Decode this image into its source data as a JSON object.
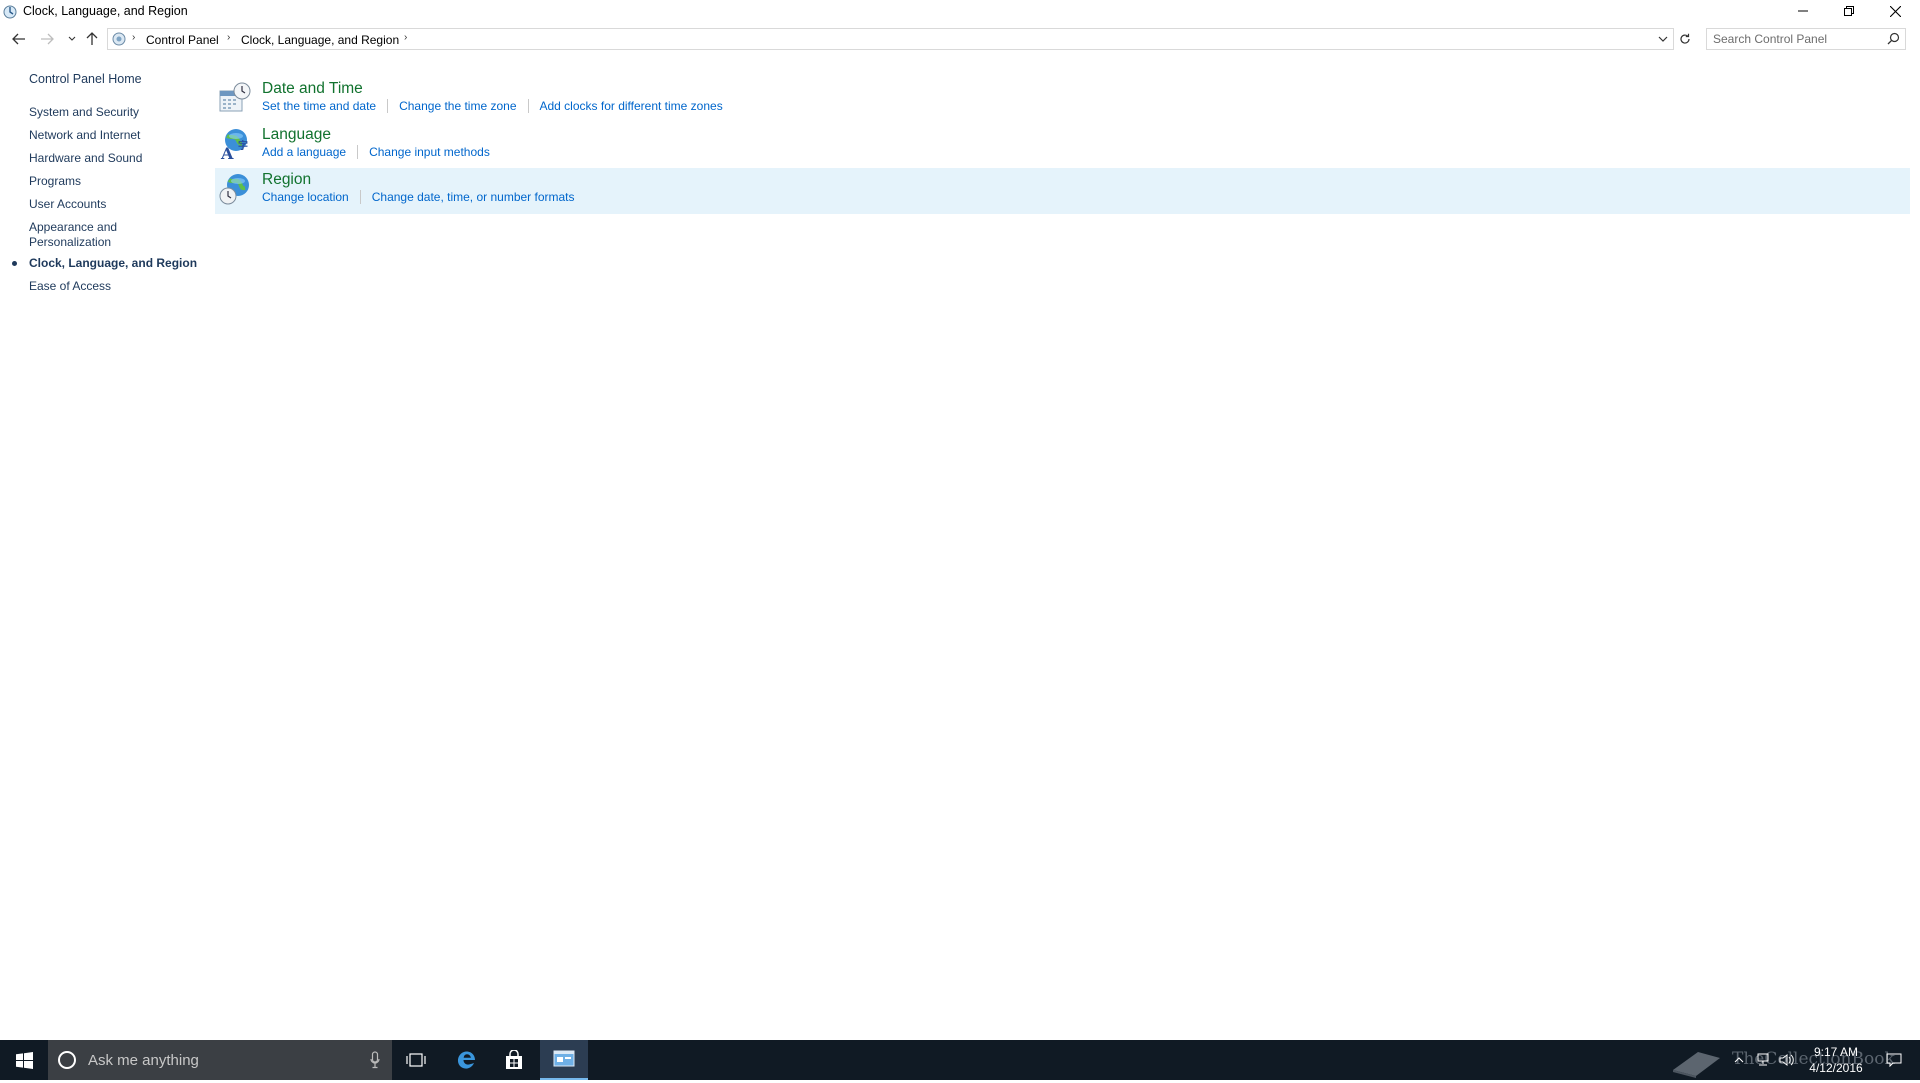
{
  "window": {
    "title": "Clock, Language, and Region"
  },
  "address": {
    "crumbs": [
      "Control Panel",
      "Clock, Language, and Region"
    ],
    "search_placeholder": "Search Control Panel"
  },
  "leftnav": {
    "home": "Control Panel Home",
    "items": [
      {
        "label": "System and Security"
      },
      {
        "label": "Network and Internet"
      },
      {
        "label": "Hardware and Sound"
      },
      {
        "label": "Programs"
      },
      {
        "label": "User Accounts"
      },
      {
        "label": "Appearance and Personalization"
      },
      {
        "label": "Clock, Language, and Region"
      },
      {
        "label": "Ease of Access"
      }
    ]
  },
  "categories": [
    {
      "title": "Date and Time",
      "links": [
        "Set the time and date",
        "Change the time zone",
        "Add clocks for different time zones"
      ]
    },
    {
      "title": "Language",
      "links": [
        "Add a language",
        "Change input methods"
      ]
    },
    {
      "title": "Region",
      "links": [
        "Change location",
        "Change date, time, or number formats"
      ]
    }
  ],
  "taskbar": {
    "search_text": "Ask me anything",
    "time": "9:17 AM",
    "date": "4/12/2016",
    "watermark": "TheCollectionBook"
  },
  "colors": {
    "category_title": "#11722e",
    "link": "#0066cc",
    "nav_text": "#1e395b",
    "selected_row": "#e5f3fb",
    "taskbar": "#101a24"
  }
}
